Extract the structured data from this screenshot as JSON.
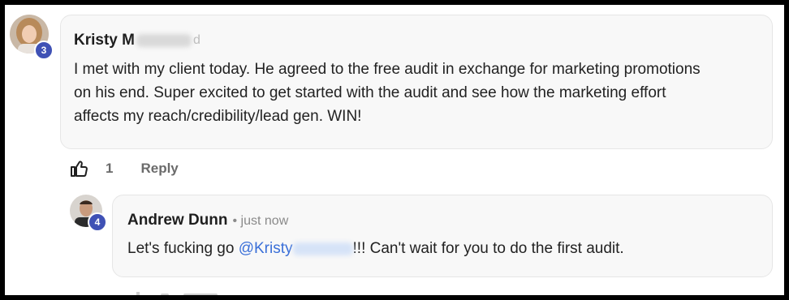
{
  "comment": {
    "author_visible": "Kristy M",
    "time_fragment": "d",
    "level": "3",
    "text": "I met with my client today. He agreed to the free audit in exchange for marketing promotions on his end. Super excited to get started with the audit and see how the marketing effort affects my reach/credibility/lead gen. WIN!",
    "like_count": "1",
    "reply_label": "Reply"
  },
  "reply": {
    "author": "Andrew Dunn",
    "timestamp": "• just now",
    "level": "4",
    "text_before": "Let's fucking go ",
    "mention": "@Kristy",
    "text_after": "!!! Can't wait for you to do the first audit."
  },
  "colors": {
    "badge": "#3f51b5",
    "mention": "#3a6fd8",
    "bubble": "#f8f8f8"
  }
}
